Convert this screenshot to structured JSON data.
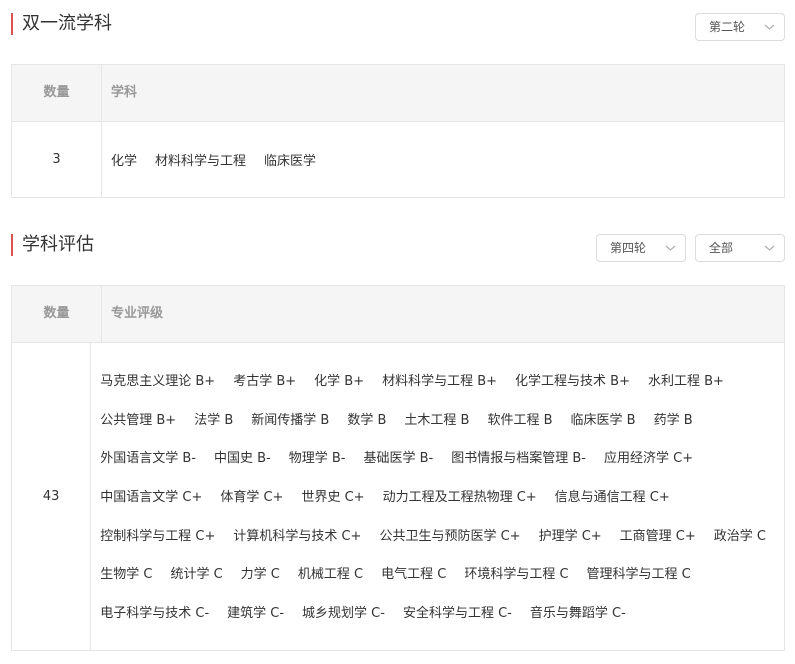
{
  "double_first_class": {
    "title": "双一流学科",
    "round_select": "第二轮",
    "header_count": "数量",
    "header_subjects": "学科",
    "count": "3",
    "subjects": [
      "化学",
      "材料科学与工程",
      "临床医学"
    ]
  },
  "evaluation": {
    "title": "学科评估",
    "round_select": "第四轮",
    "level_select": "全部",
    "header_count": "数量",
    "header_grades": "专业评级",
    "count": "43",
    "rows": [
      [
        "马克思主义理论 B+",
        "考古学 B+",
        "化学 B+",
        "材料科学与工程 B+",
        "化学工程与技术 B+",
        "水利工程 B+"
      ],
      [
        "公共管理 B+",
        "法学 B",
        "新闻传播学 B",
        "数学 B",
        "土木工程 B",
        "软件工程 B",
        "临床医学 B",
        "药学 B"
      ],
      [
        "外国语言文学 B-",
        "中国史 B-",
        "物理学 B-",
        "基础医学 B-",
        "图书情报与档案管理 B-",
        "应用经济学 C+"
      ],
      [
        "中国语言文学 C+",
        "体育学 C+",
        "世界史 C+",
        "动力工程及工程热物理 C+",
        "信息与通信工程 C+"
      ],
      [
        "控制科学与工程 C+",
        "计算机科学与技术 C+",
        "公共卫生与预防医学 C+",
        "护理学 C+",
        "工商管理 C+",
        "政治学 C"
      ],
      [
        "生物学 C",
        "统计学 C",
        "力学 C",
        "机械工程 C",
        "电气工程 C",
        "环境科学与工程 C",
        "管理科学与工程 C"
      ],
      [
        "电子科学与技术 C-",
        "建筑学 C-",
        "城乡规划学 C-",
        "安全科学与工程 C-",
        "音乐与舞蹈学 C-"
      ]
    ]
  },
  "icons": {
    "select_chevron": "chevron-down-icon"
  },
  "colors": {
    "accent": "#d9534f",
    "header_bg": "#f5f5f5",
    "border": "#e6e6e6",
    "muted_text": "#999999"
  }
}
